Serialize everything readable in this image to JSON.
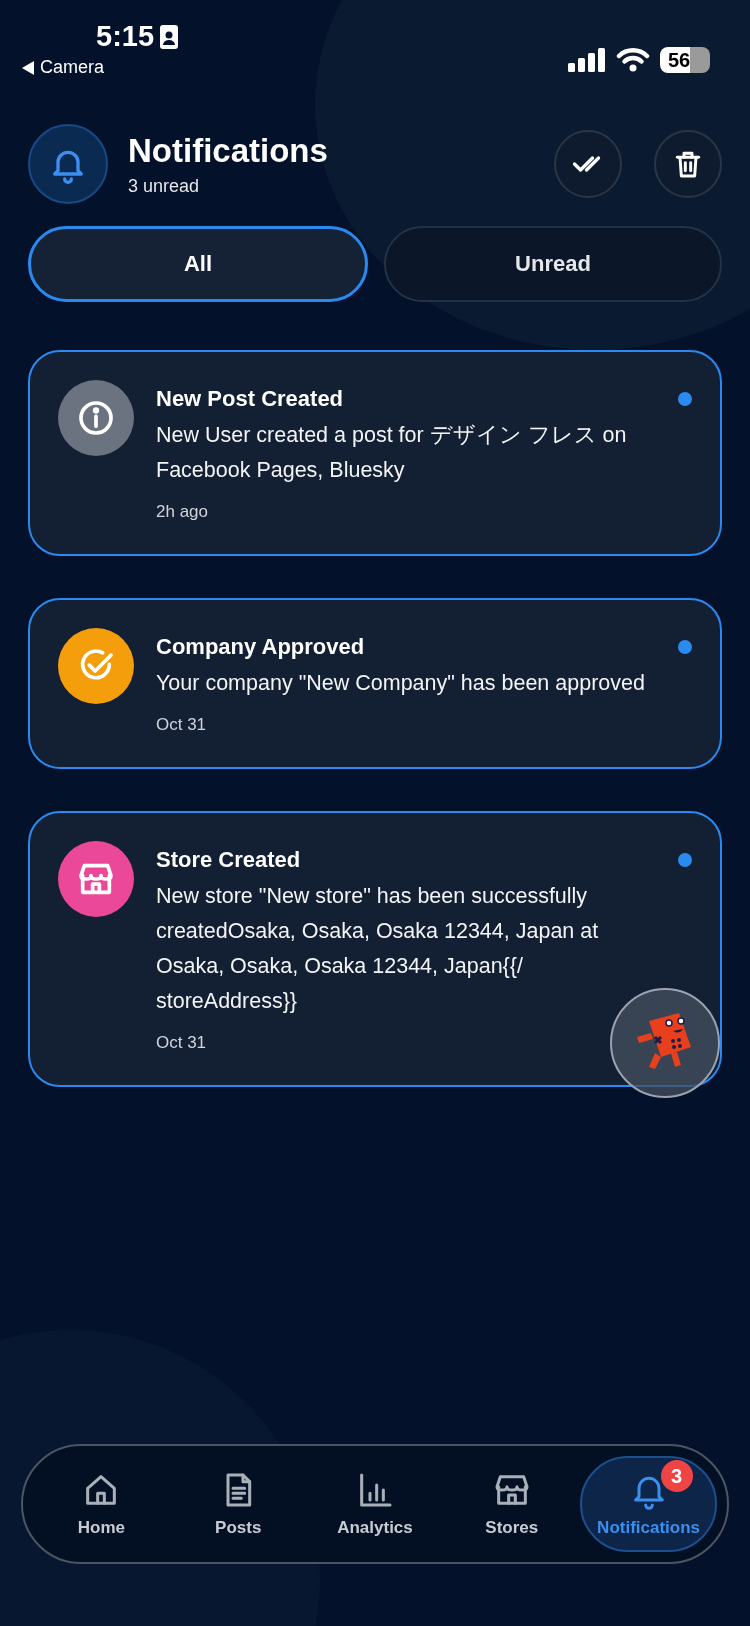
{
  "status_bar": {
    "time": "5:15",
    "back_label": "Camera",
    "battery": "56"
  },
  "header": {
    "title": "Notifications",
    "subtitle": "3 unread"
  },
  "filter_tabs": [
    {
      "label": "All",
      "selected": true
    },
    {
      "label": "Unread",
      "selected": false
    }
  ],
  "notifications": [
    {
      "kind": "info",
      "color": "#6b7280",
      "title": "New Post Created",
      "message": "New User created a post for デザイン フレス on Facebook Pages, Bluesky",
      "time": "2h ago",
      "unread": true
    },
    {
      "kind": "approved",
      "color": "#f59e0b",
      "title": "Company Approved",
      "message": "Your company \"New Company\" has been approved",
      "time": "Oct 31",
      "unread": true
    },
    {
      "kind": "store",
      "color": "#ec4899",
      "title": "Store Created",
      "message": "New store \"New store\" has been successfully createdOsaka, Osaka, Osaka 12344, Japan at Osaka, Osaka, Osaka 12344, Japan{{/ storeAddress}}",
      "time": "Oct 31",
      "unread": true
    }
  ],
  "bottom_nav": [
    {
      "kind": "home",
      "label": "Home",
      "selected": false
    },
    {
      "kind": "posts",
      "label": "Posts",
      "selected": false
    },
    {
      "kind": "analytics",
      "label": "Analytics",
      "selected": false
    },
    {
      "kind": "stores",
      "label": "Stores",
      "selected": false
    },
    {
      "kind": "notifications",
      "label": "Notifications",
      "selected": true,
      "badge": "3"
    }
  ]
}
